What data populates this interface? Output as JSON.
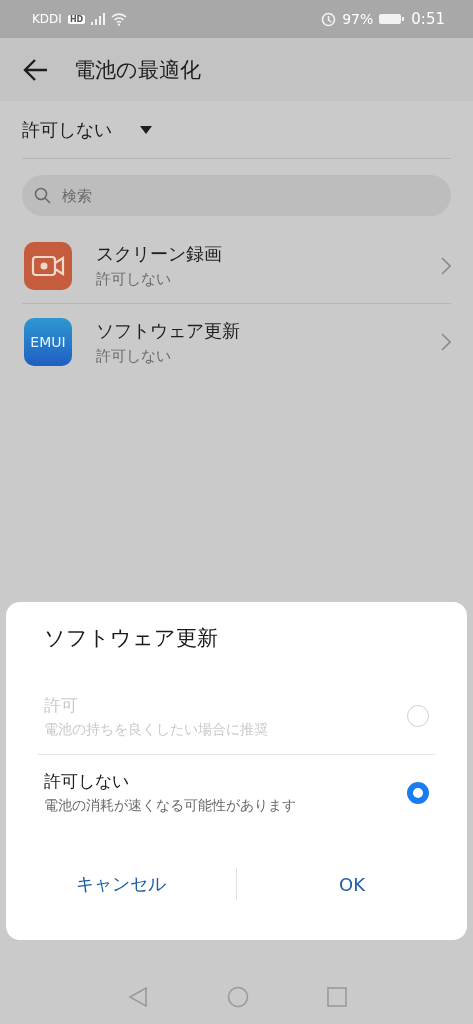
{
  "status_bar": {
    "carrier": "KDDI",
    "hd_badge": "HD",
    "battery_percent": "97%",
    "time": "0:51"
  },
  "app_bar": {
    "title": "電池の最適化"
  },
  "filter": {
    "label": "許可しない"
  },
  "search": {
    "placeholder": "検索"
  },
  "apps": [
    {
      "kind": "recorder",
      "name": "スクリーン録画",
      "status": "許可しない"
    },
    {
      "kind": "emui",
      "icon_label": "EMUI",
      "name": "ソフトウェア更新",
      "status": "許可しない"
    }
  ],
  "dialog": {
    "title": "ソフトウェア更新",
    "options": [
      {
        "label": "許可",
        "description": "電池の持ちを良くしたい場合に推奨",
        "selected": false,
        "disabled": true
      },
      {
        "label": "許可しない",
        "description": "電池の消耗が速くなる可能性があります",
        "selected": true,
        "disabled": false
      }
    ],
    "buttons": [
      "キャンセル",
      "OK"
    ]
  }
}
